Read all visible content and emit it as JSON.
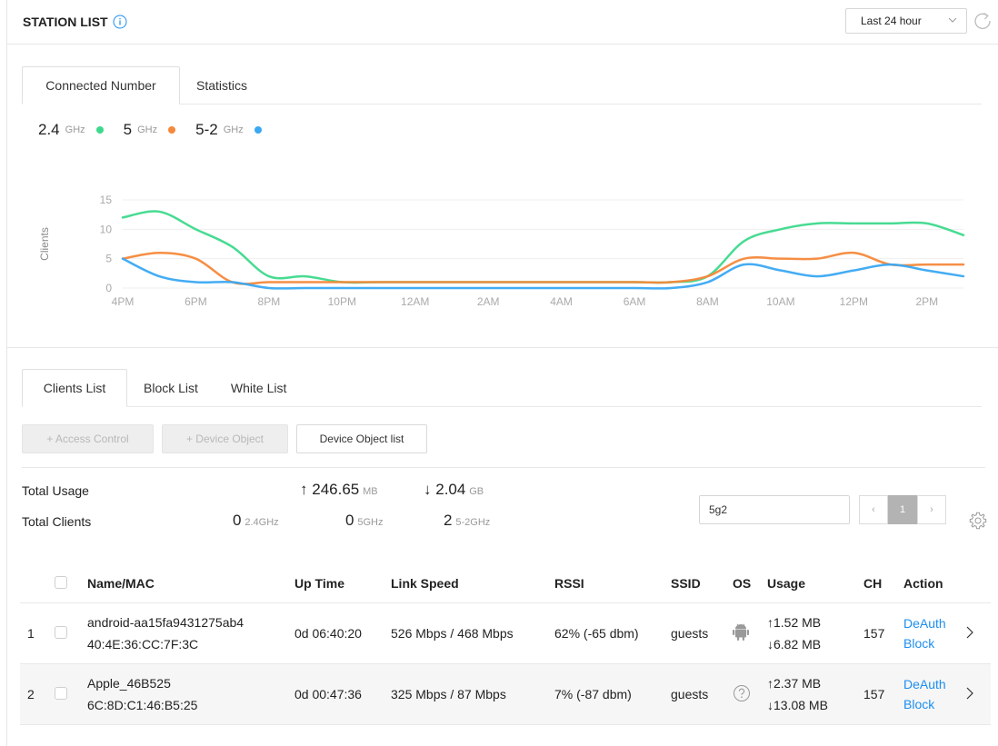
{
  "header": {
    "title": "STATION LIST",
    "range": "Last 24 hour"
  },
  "chart_tabs": [
    "Connected Number",
    "Statistics"
  ],
  "legend": [
    {
      "band": "2.4",
      "unit": "GHz",
      "color": "#3dd98c"
    },
    {
      "band": "5",
      "unit": "GHz",
      "color": "#f5883a"
    },
    {
      "band": "5-2",
      "unit": "GHz",
      "color": "#3aa8f2"
    }
  ],
  "chart_data": {
    "type": "line",
    "ylabel": "Clients",
    "yticks": [
      0,
      5,
      10,
      15
    ],
    "ylim": [
      0,
      15
    ],
    "x": [
      "4PM",
      "5PM",
      "6PM",
      "7PM",
      "8PM",
      "9PM",
      "10PM",
      "11PM",
      "12AM",
      "1AM",
      "2AM",
      "3AM",
      "4AM",
      "5AM",
      "6AM",
      "7AM",
      "8AM",
      "9AM",
      "10AM",
      "11AM",
      "12PM",
      "1PM",
      "2PM",
      "3PM"
    ],
    "xticks": [
      "4PM",
      "6PM",
      "8PM",
      "10PM",
      "12AM",
      "2AM",
      "4AM",
      "6AM",
      "8AM",
      "10AM",
      "12PM",
      "2PM"
    ],
    "series": [
      {
        "name": "2.4 GHz",
        "color": "#3dd98c",
        "values": [
          12,
          13,
          10,
          7,
          2,
          2,
          1,
          1,
          1,
          1,
          1,
          1,
          1,
          1,
          1,
          1,
          2,
          8,
          10,
          11,
          11,
          11,
          11,
          9
        ]
      },
      {
        "name": "5 GHz",
        "color": "#f5883a",
        "values": [
          5,
          6,
          5,
          1,
          1,
          1,
          1,
          1,
          1,
          1,
          1,
          1,
          1,
          1,
          1,
          1,
          2,
          5,
          5,
          5,
          6,
          4,
          4,
          4
        ]
      },
      {
        "name": "5-2 GHz",
        "color": "#3aa8f2",
        "values": [
          5,
          2,
          1,
          1,
          0,
          0,
          0,
          0,
          0,
          0,
          0,
          0,
          0,
          0,
          0,
          0,
          1,
          4,
          3,
          2,
          3,
          4,
          3,
          2
        ]
      }
    ]
  },
  "list_tabs": [
    "Clients List",
    "Block List",
    "White List"
  ],
  "buttons": {
    "access_control": "+ Access Control",
    "device_object": "+ Device Object",
    "device_object_list": "Device Object list"
  },
  "totals": {
    "usage_label": "Total Usage",
    "clients_label": "Total Clients",
    "up_value": "246.65",
    "up_unit": "MB",
    "down_value": "2.04",
    "down_unit": "GB",
    "c24": "0",
    "c24_unit": "2.4GHz",
    "c5": "0",
    "c5_unit": "5GHz",
    "c52": "2",
    "c52_unit": "5-2GHz"
  },
  "search": {
    "value": "5g2"
  },
  "pager": {
    "prev": "‹",
    "page": "1",
    "next": "›"
  },
  "table": {
    "headers": [
      "Name/MAC",
      "Up Time",
      "Link Speed",
      "RSSI",
      "SSID",
      "OS",
      "Usage",
      "CH",
      "Action"
    ],
    "rows": [
      {
        "idx": "1",
        "name": "android-aa15fa9431275ab4",
        "mac": "40:4E:36:CC:7F:3C",
        "uptime": "0d 06:40:20",
        "speed": "526 Mbps / 468 Mbps",
        "rssi": "62% (-65 dbm)",
        "ssid": "guests",
        "os_icon": "android-icon",
        "up": "↑1.52 MB",
        "down": "↓6.82 MB",
        "ch": "157",
        "deauth": "DeAuth",
        "block": "Block"
      },
      {
        "idx": "2",
        "name": "Apple_46B525",
        "mac": "6C:8D:C1:46:B5:25",
        "uptime": "0d 00:47:36",
        "speed": "325 Mbps / 87 Mbps",
        "rssi": "7% (-87 dbm)",
        "ssid": "guests",
        "os_icon": "unknown-os-icon",
        "up": "↑2.37 MB",
        "down": "↓13.08 MB",
        "ch": "157",
        "deauth": "DeAuth",
        "block": "Block"
      }
    ]
  }
}
